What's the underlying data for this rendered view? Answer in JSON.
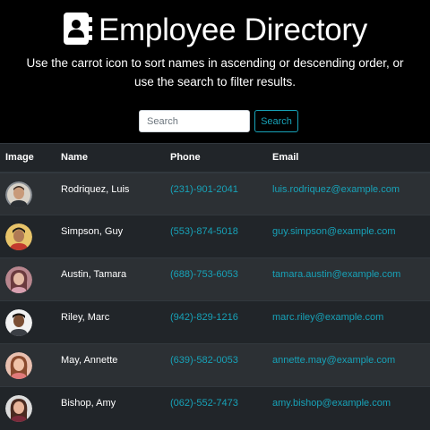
{
  "header": {
    "title": "Employee Directory",
    "subtitle": "Use the carrot icon to sort names in ascending or descending order, or use the search to filter results.",
    "icon": "address-book-icon"
  },
  "search": {
    "placeholder": "Search",
    "value": "",
    "button_label": "Search",
    "button_color": "#17a2b8"
  },
  "table": {
    "columns": [
      "Image",
      "Name",
      "Phone",
      "Email"
    ],
    "rows": [
      {
        "name": "Rodriquez, Luis",
        "phone": "(231)-901-2041",
        "email": "luis.rodriquez@example.com",
        "avatar": "avatar-luis"
      },
      {
        "name": "Simpson, Guy",
        "phone": "(553)-874-5018",
        "email": "guy.simpson@example.com",
        "avatar": "avatar-guy"
      },
      {
        "name": "Austin, Tamara",
        "phone": "(688)-753-6053",
        "email": "tamara.austin@example.com",
        "avatar": "avatar-tamara"
      },
      {
        "name": "Riley, Marc",
        "phone": "(942)-829-1216",
        "email": "marc.riley@example.com",
        "avatar": "avatar-marc"
      },
      {
        "name": "May, Annette",
        "phone": "(639)-582-0053",
        "email": "annette.may@example.com",
        "avatar": "avatar-annette"
      },
      {
        "name": "Bishop, Amy",
        "phone": "(062)-552-7473",
        "email": "amy.bishop@example.com",
        "avatar": "avatar-amy"
      }
    ]
  },
  "colors": {
    "background": "#000000",
    "table_dark": "#212529",
    "table_stripe": "#2c3034",
    "link": "#17a2b8"
  }
}
